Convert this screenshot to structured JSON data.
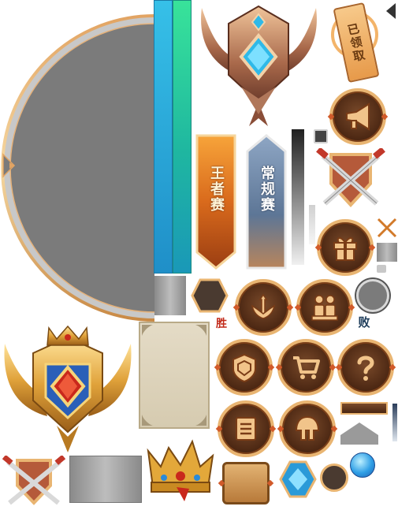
{
  "labels": {
    "claimed_stamp": "已领取",
    "king_match_banner": "王者赛",
    "regular_match_banner": "常规赛",
    "win_tag": "胜",
    "lose_tag": "败"
  },
  "icons": [
    "large-circle-frame",
    "blue-vertical-bar",
    "green-vertical-bar",
    "bronze-rank-emblem",
    "claimed-stamp",
    "back-arrow-icon",
    "horn-icon",
    "crossed-swords-shield-emblem",
    "gift-icon",
    "tournament-icon",
    "ranking-icon",
    "shield-icon",
    "cart-icon",
    "help-icon",
    "menu-list-icon",
    "helmet-icon",
    "gold-rank-emblem",
    "crown-icon",
    "blue-gem-icon",
    "blue-orb-icon",
    "hexagon-slot",
    "round-slot",
    "parchment-panel",
    "square-frame"
  ],
  "colors": {
    "gold": "#e9b572",
    "bronze_dark": "#4a2612",
    "blue_bar": "#2aa3d8",
    "green_bar": "#2fd08a",
    "gray_fill": "#7a7a7a",
    "parchment": "#ddd3bc",
    "stamp_text": "#6b3b12",
    "banner_king": "#e07a1e",
    "banner_regular": "#6e8fb0"
  }
}
